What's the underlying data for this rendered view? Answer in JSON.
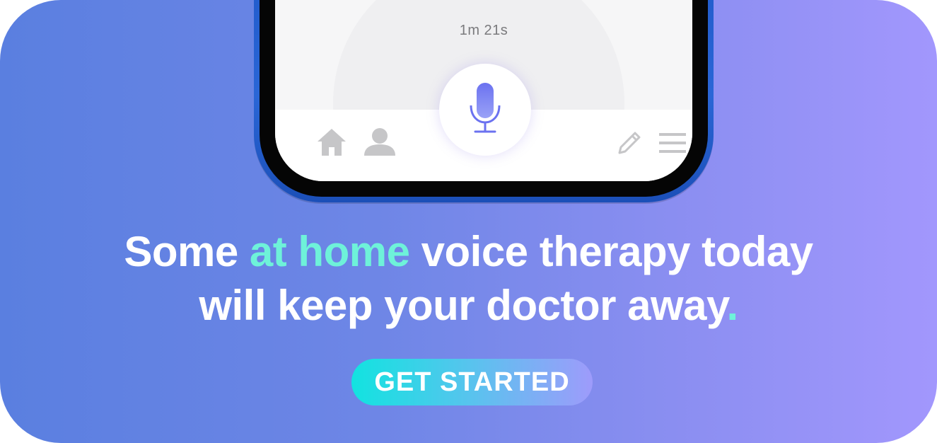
{
  "phone": {
    "timer": "1m 21s",
    "icons": {
      "mic": "microphone-icon",
      "home": "home-icon",
      "profile": "user-icon",
      "edit": "pencil-icon",
      "menu": "hamburger-menu-icon"
    }
  },
  "headline": {
    "line1_part1": "Some ",
    "line1_accent": "at home",
    "line1_part2": " voice therapy today",
    "line2": "will keep your doctor away",
    "dot": "."
  },
  "cta": {
    "label": "GET STARTED"
  },
  "colors": {
    "accent": "#6ef2d9",
    "gradient_start": "#5a7fe0",
    "gradient_end": "#a297fd"
  }
}
